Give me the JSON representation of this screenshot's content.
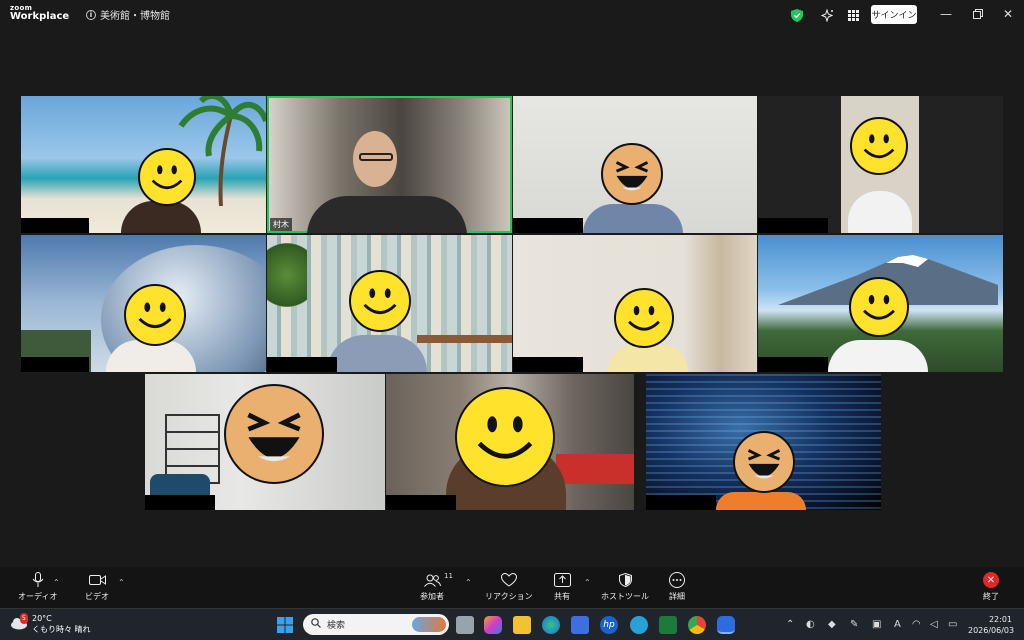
{
  "app": {
    "logo_line1": "zoom",
    "logo_line2": "Workplace",
    "meeting_title": "美術館・博物館",
    "signin_label": "サインイン"
  },
  "participants": [
    {
      "id": "p1",
      "name": "",
      "bg": "beach",
      "emoji": "smile"
    },
    {
      "id": "p2",
      "name": "村木",
      "bg": "room",
      "emoji": "none",
      "active": true
    },
    {
      "id": "p3",
      "name": "",
      "bg": "wall",
      "emoji": "laugh"
    },
    {
      "id": "p4",
      "name": "",
      "bg": "dark-room",
      "emoji": "smile"
    },
    {
      "id": "p5",
      "name": "",
      "bg": "sky-sculpture",
      "emoji": "smile"
    },
    {
      "id": "p6",
      "name": "",
      "bg": "wood-wall",
      "emoji": "smile"
    },
    {
      "id": "p7",
      "name": "",
      "bg": "curtain",
      "emoji": "smile"
    },
    {
      "id": "p8",
      "name": "",
      "bg": "mount-fuji",
      "emoji": "smile"
    },
    {
      "id": "p9",
      "name": "",
      "bg": "living-room",
      "emoji": "laugh"
    },
    {
      "id": "p10",
      "name": "",
      "bg": "street",
      "emoji": "smile"
    },
    {
      "id": "p11",
      "name": "",
      "bg": "digital-art",
      "emoji": "laugh"
    }
  ],
  "toolbar": {
    "audio": "オーディオ",
    "video": "ビデオ",
    "participants": "参加者",
    "participant_count": "11",
    "reaction": "リアクション",
    "share": "共有",
    "host_tools": "ホストツール",
    "more": "詳細",
    "end": "終了"
  },
  "taskbar": {
    "weather_temp": "20°C",
    "weather_desc": "くもり時々 晴れ",
    "weather_badge": "5",
    "search_placeholder": "検索",
    "time": "22:01",
    "date": "2026/06/03",
    "ime": "A"
  },
  "colors": {
    "active_speaker": "#22c55e",
    "emoji_yellow": "#ffe22b",
    "end_red": "#e02828"
  }
}
